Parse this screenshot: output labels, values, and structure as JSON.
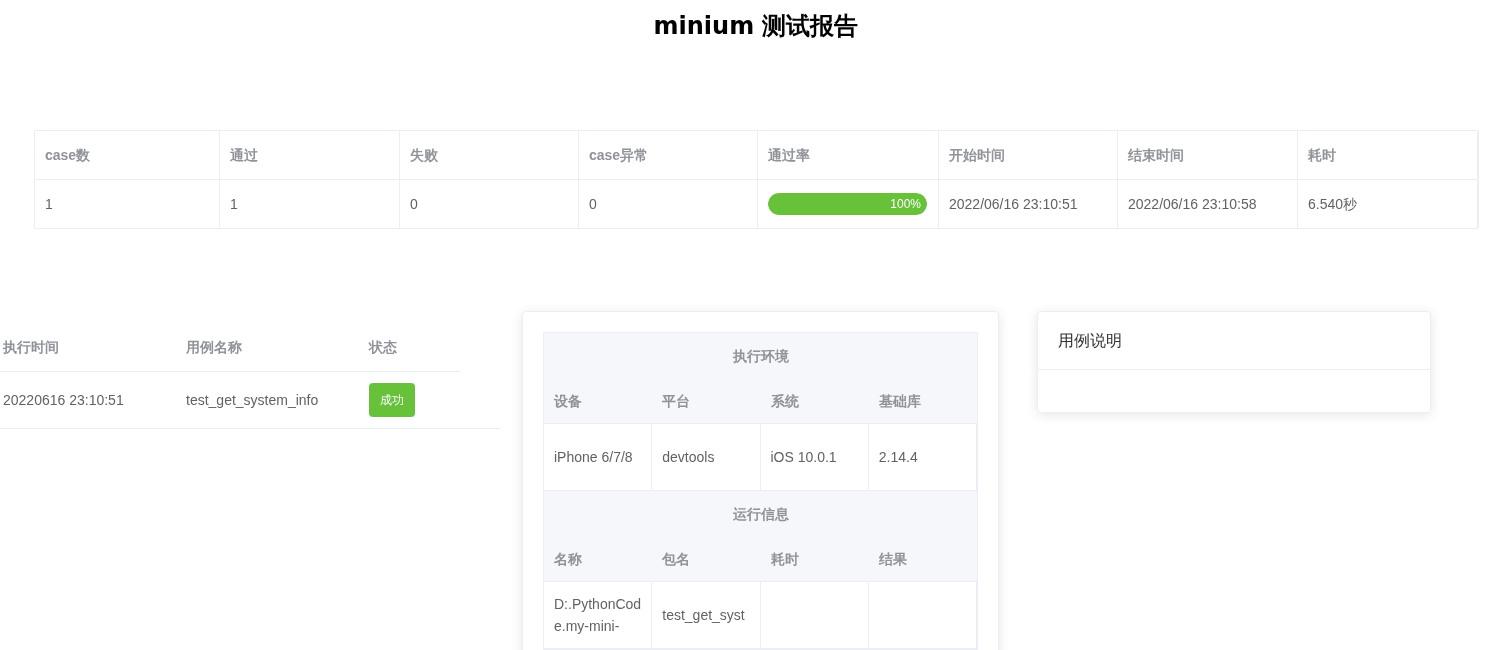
{
  "title": "minium 测试报告",
  "summary": {
    "columns": [
      "case数",
      "通过",
      "失败",
      "case异常",
      "通过率",
      "开始时间",
      "结束时间",
      "耗时"
    ],
    "rows": [
      [
        {
          "kind": "text",
          "text": "1"
        },
        {
          "kind": "text",
          "text": "1"
        },
        {
          "kind": "text",
          "text": "0"
        },
        {
          "kind": "text",
          "text": "0"
        },
        {
          "kind": "progress",
          "level": 1,
          "label": "100%"
        },
        {
          "kind": "text",
          "text": "2022/06/16 23:10:51"
        },
        {
          "kind": "text",
          "text": "2022/06/16 23:10:58"
        },
        {
          "kind": "text",
          "text": "6.540秒"
        }
      ]
    ]
  },
  "cases": {
    "columns": [
      "执行时间",
      "用例名称",
      "状态"
    ],
    "rows": [
      {
        "time": "20220616 23:10:51",
        "name": "test_get_system_info",
        "status": {
          "kind": "success",
          "label": "成功"
        }
      }
    ]
  },
  "detail": {
    "sections": [
      {
        "title": "执行环境",
        "columns": [
          "设备",
          "平台",
          "系统",
          "基础库"
        ],
        "rows": [
          [
            "iPhone 6/7/8",
            "devtools",
            "iOS 10.0.1",
            "2.14.4"
          ]
        ]
      },
      {
        "title": "运行信息",
        "columns": [
          "名称",
          "包名",
          "耗时",
          "结果"
        ],
        "rows": [
          [
            "D:.PythonCode.my-mini-",
            "test_get_syst",
            "",
            ""
          ]
        ]
      }
    ]
  },
  "description": {
    "title": "用例说明"
  }
}
